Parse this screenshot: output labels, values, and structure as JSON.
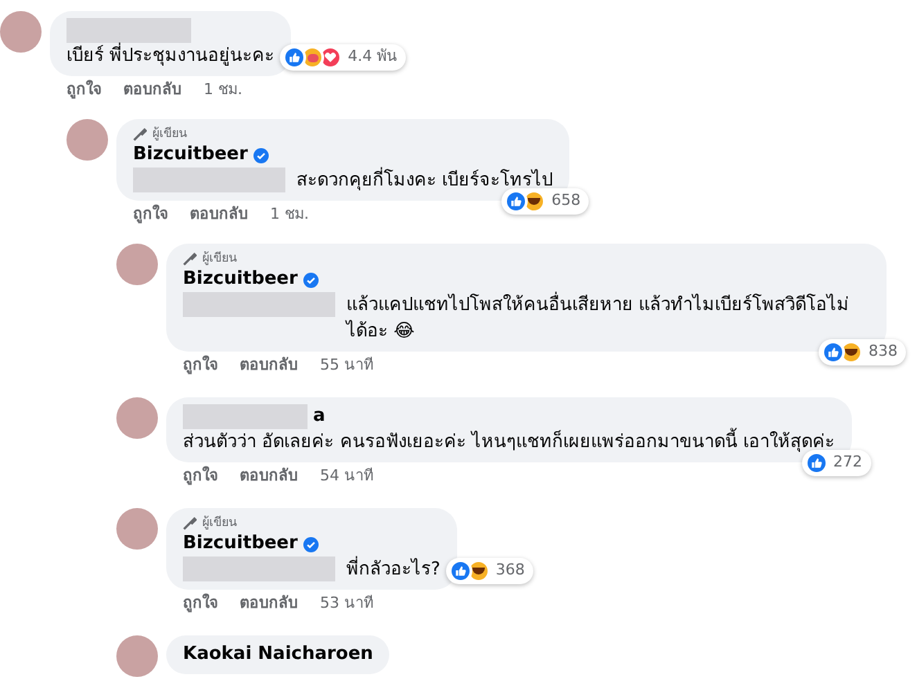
{
  "comments": [
    {
      "name_redacted": true,
      "text": "เบียร์ พี่ประชุมงานอยู่นะคะ",
      "reactions": [
        {
          "kind": "like"
        },
        {
          "kind": "care"
        },
        {
          "kind": "love"
        }
      ],
      "reaction_count": "4.4 พัน",
      "reactions_beside_text": true,
      "actions": [
        "ถูกใจ",
        "ตอบกลับ"
      ],
      "time": "1 ชม.",
      "children": [
        {
          "badge": "ผู้เขียน",
          "author": "Bizcuitbeer",
          "verified": true,
          "text": "สะดวกคุยกี่โมงคะ เบียร์จะโทรไป",
          "text_redacted": true,
          "reactions": [
            {
              "kind": "like"
            },
            {
              "kind": "haha"
            }
          ],
          "reaction_count": "658",
          "reactions_beside_text": false,
          "actions": [
            "ถูกใจ",
            "ตอบกลับ"
          ],
          "time": "1 ชม.",
          "children": [
            {
              "badge": "ผู้เขียน",
              "author": "Bizcuitbeer",
              "verified": true,
              "text": "แล้วแคปแชทไปโพสให้คนอื่นเสียหาย แล้วทำไมเบียร์โพสวิดีโอไม่ได้อะ 😂",
              "text_redacted": true,
              "reactions": [
                {
                  "kind": "like"
                },
                {
                  "kind": "haha"
                }
              ],
              "reaction_count": "838",
              "reactions_beside_text": false,
              "actions": [
                "ถูกใจ",
                "ตอบกลับ"
              ],
              "time": "55 นาที"
            },
            {
              "author": "a",
              "name_redacted": true,
              "text": "ส่วนตัวว่า อัดเลยค่ะ คนรอฟังเยอะค่ะ ไหนๆแชทก็เผยแพร่ออกมาขนาดนี้ เอาให้สุดค่ะ",
              "reactions": [
                {
                  "kind": "like"
                }
              ],
              "reaction_count": "272",
              "reactions_beside_text": false,
              "actions": [
                "ถูกใจ",
                "ตอบกลับ"
              ],
              "time": "54 นาที"
            },
            {
              "badge": "ผู้เขียน",
              "author": "Bizcuitbeer",
              "verified": true,
              "text": "พี่กลัวอะไร?",
              "text_redacted": true,
              "reactions": [
                {
                  "kind": "like"
                },
                {
                  "kind": "haha"
                }
              ],
              "reaction_count": "368",
              "reactions_beside_text": true,
              "actions": [
                "ถูกใจ",
                "ตอบกลับ"
              ],
              "time": "53 นาที"
            },
            {
              "author": "Kaokai Naicharoen"
            }
          ]
        }
      ]
    }
  ]
}
